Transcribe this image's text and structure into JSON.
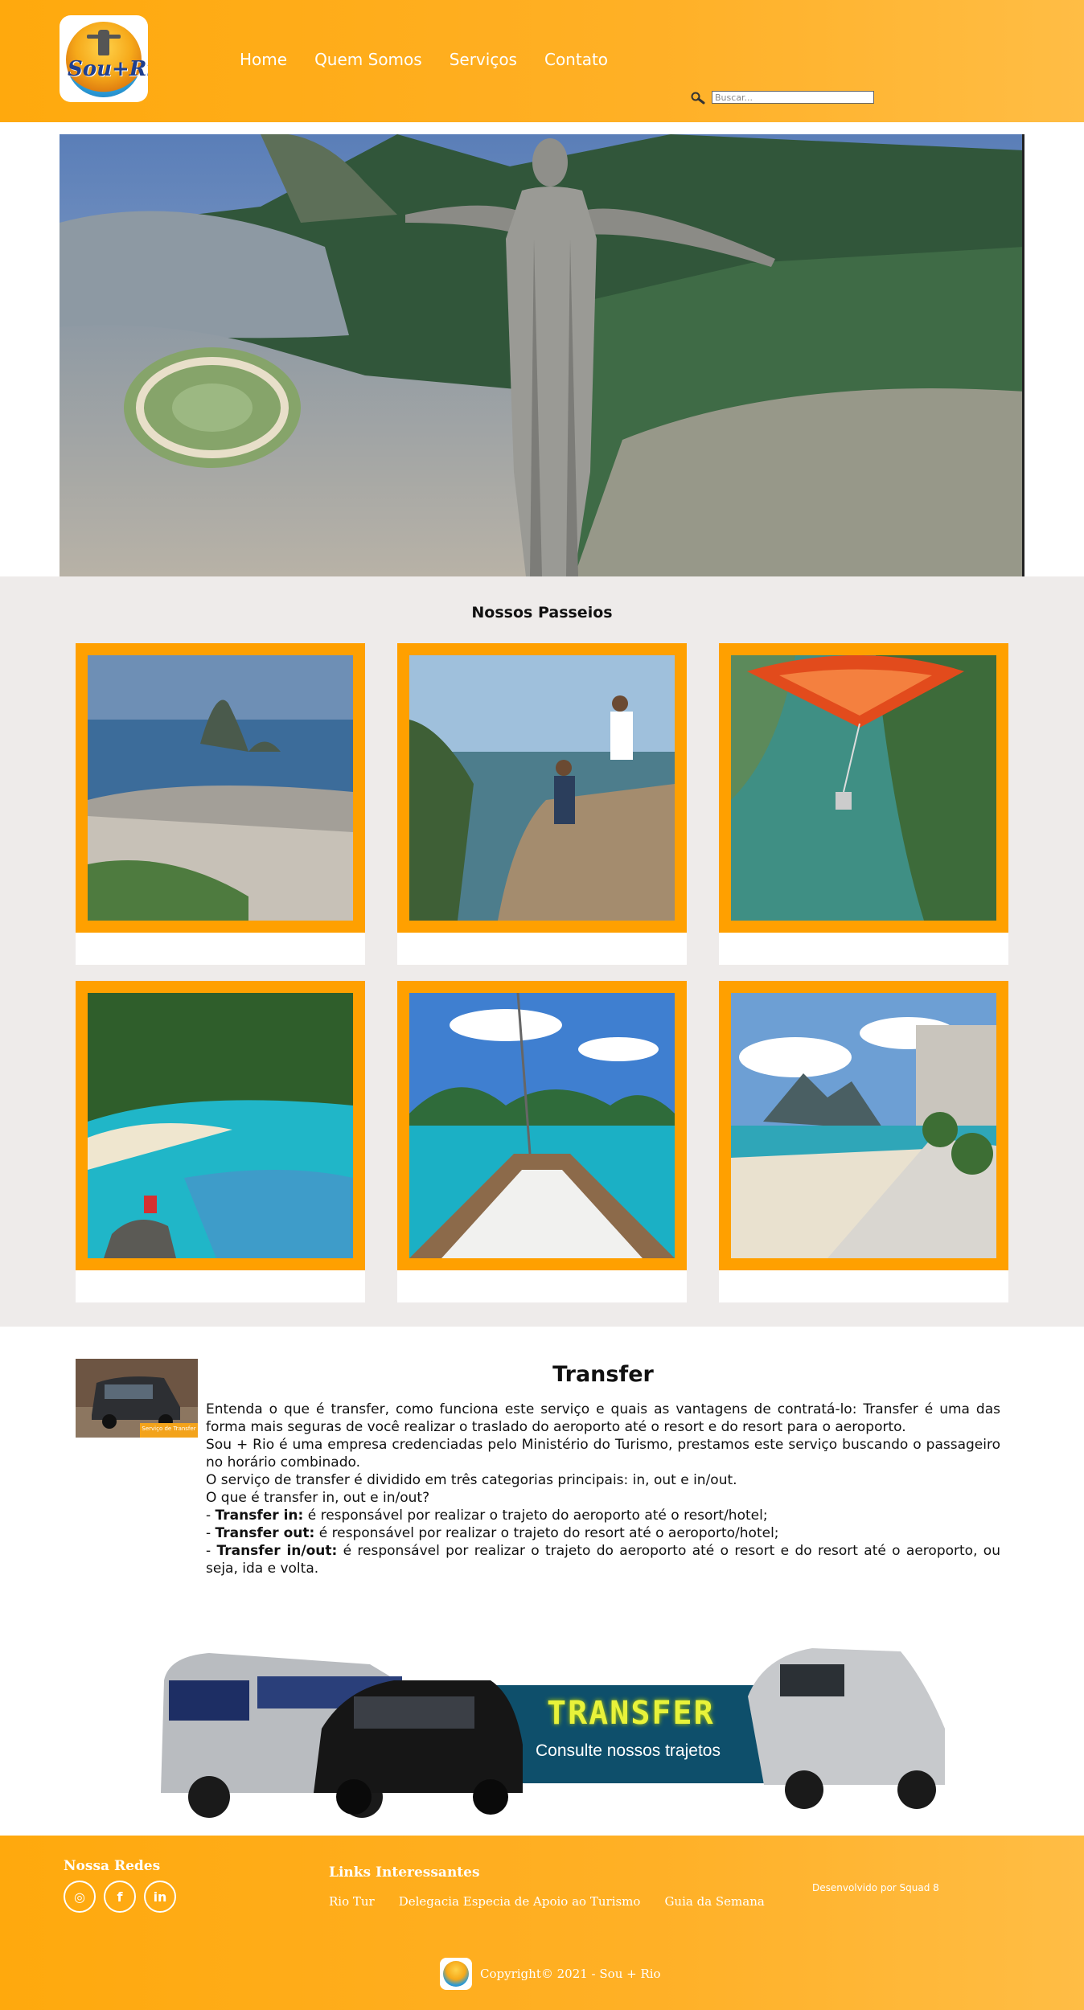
{
  "header": {
    "logo_text": "Sou+Rio",
    "nav": [
      {
        "label": "Home"
      },
      {
        "label": "Quem Somos"
      },
      {
        "label": "Serviços"
      },
      {
        "label": "Contato"
      }
    ],
    "search": {
      "placeholder": "Buscar..."
    }
  },
  "hero": {
    "next_label": ">>"
  },
  "tours": {
    "title": "Nossos Passeios",
    "cards": [
      {
        "image": "sugarloaf-bay"
      },
      {
        "image": "couple-on-rock"
      },
      {
        "image": "hang-glider"
      },
      {
        "image": "beach-cove"
      },
      {
        "image": "boat-bow"
      },
      {
        "image": "ipanema-boardwalk"
      }
    ]
  },
  "transfer": {
    "title": "Transfer",
    "thumb_caption": "Serviço de Transfer",
    "paragraphs": [
      "Entenda o que é transfer, como funciona este serviço e quais as vantagens de contratá-lo: Transfer é uma das forma mais seguras de você realizar o traslado do aeroporto até o resort e do resort para o aeroporto.",
      "Sou + Rio é uma empresa credenciadas pelo Ministério do Turismo, prestamos este serviço buscando o passageiro no horário combinado.",
      "O serviço de transfer é dividido em três categorias principais: in, out e in/out.",
      "O que é transfer in, out e in/out?"
    ],
    "items": [
      {
        "label": "Transfer in:",
        "text": " é responsável por realizar o trajeto do aeroporto até o resort/hotel;"
      },
      {
        "label": "Transfer out:",
        "text": " é responsável por realizar o trajeto do resort até o aeroporto/hotel;"
      },
      {
        "label": "Transfer in/out:",
        "text": " é responsável por realizar o trajeto do aeroporto até o resort e do resort até o aeroporto, ou seja, ida e volta."
      }
    ],
    "banner": {
      "big": "TRANSFER",
      "small": "Consulte nossos trajetos"
    }
  },
  "footer": {
    "social_title": "Nossa Redes",
    "social": [
      {
        "icon": "instagram-icon",
        "glyph": "◎"
      },
      {
        "icon": "facebook-icon",
        "glyph": "f"
      },
      {
        "icon": "linkedin-icon",
        "glyph": "in"
      }
    ],
    "links_title": "Links Interessantes",
    "links": [
      {
        "label": "Rio Tur"
      },
      {
        "label": "Delegacia Especia de Apoio ao Turismo"
      },
      {
        "label": "Guia da Semana"
      }
    ],
    "dev": "Desenvolvido por Squad 8",
    "copyright": "Copyright© 2021 - Sou + Rio"
  }
}
